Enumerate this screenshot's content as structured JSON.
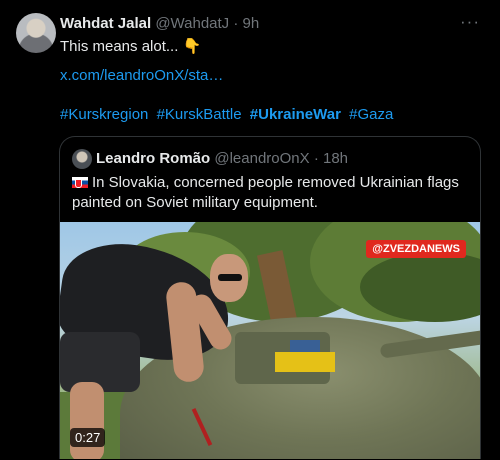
{
  "tweet": {
    "author_name": "Wahdat Jalal",
    "author_handle": "@WahdatJ",
    "separator": "·",
    "time": "9h",
    "more_icon": "ellipsis-icon",
    "text": "This means alot... 👇",
    "link": "x.com/leandroOnX/sta…",
    "hashtags": [
      {
        "text": "#Kurskregion",
        "bold": false
      },
      {
        "text": "#KurskBattle",
        "bold": false
      },
      {
        "text": "#UkraineWar",
        "bold": true
      },
      {
        "text": "#Gaza",
        "bold": false
      }
    ]
  },
  "quote": {
    "author_name": "Leandro Romão",
    "author_handle": "@leandroOnX",
    "separator": "·",
    "time": "18h",
    "flag": "slovakia-flag",
    "text": "In Slovakia, concerned people removed Ukrainian flags painted on Soviet military equipment.",
    "media": {
      "watermark": "@ZVEZDANEWS",
      "duration": "0:27"
    }
  },
  "colors": {
    "background": "#000000",
    "text": "#e7e9ea",
    "muted": "#71767b",
    "link": "#1d9bf0",
    "border": "#2f3336",
    "badge": "#e0281e"
  }
}
